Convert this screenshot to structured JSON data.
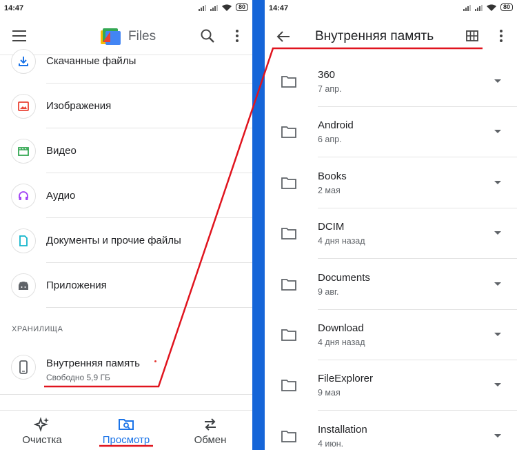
{
  "status_bar": {
    "time": "14:47",
    "battery": "80"
  },
  "left": {
    "app_title": "Files",
    "categories": [
      {
        "label": "Скачанные файлы",
        "icon": "download-icon"
      },
      {
        "label": "Изображения",
        "icon": "image-icon"
      },
      {
        "label": "Видео",
        "icon": "video-icon"
      },
      {
        "label": "Аудио",
        "icon": "headphones-icon"
      },
      {
        "label": "Документы и прочие файлы",
        "icon": "document-icon"
      },
      {
        "label": "Приложения",
        "icon": "android-icon"
      }
    ],
    "section_title": "ХРАНИЛИЩА",
    "storage": {
      "label": "Внутренняя память",
      "sub": "Свободно 5,9 ГБ",
      "icon": "phone-icon"
    },
    "nav": [
      {
        "label": "Очистка",
        "icon": "sparkle-icon"
      },
      {
        "label": "Просмотр",
        "icon": "browse-icon",
        "active": true
      },
      {
        "label": "Обмен",
        "icon": "swap-icon"
      }
    ]
  },
  "right": {
    "title": "Внутренняя память",
    "folders": [
      {
        "name": "360",
        "date": "7 апр."
      },
      {
        "name": "Android",
        "date": "6 апр."
      },
      {
        "name": "Books",
        "date": "2 мая"
      },
      {
        "name": "DCIM",
        "date": "4 дня назад"
      },
      {
        "name": "Documents",
        "date": "9 авг."
      },
      {
        "name": "Download",
        "date": "4 дня назад"
      },
      {
        "name": "FileExplorer",
        "date": "9 мая"
      },
      {
        "name": "Installation",
        "date": "4 июн."
      }
    ]
  },
  "colors": {
    "accent": "#1a73e8",
    "divider": "#1565d8",
    "annotation": "#e0141e"
  }
}
